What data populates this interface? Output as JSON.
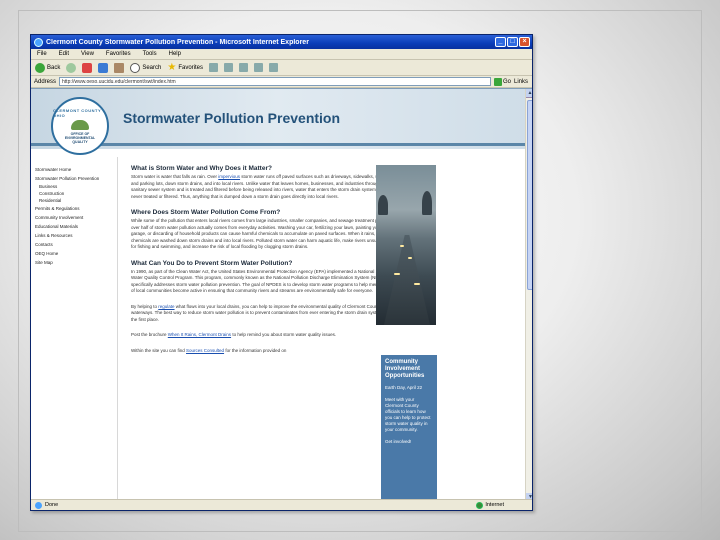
{
  "window": {
    "title": "Clermont County Stormwater Pollution Prevention - Microsoft Internet Explorer",
    "buttons": {
      "minimize": "_",
      "maximize": "□",
      "close": "×"
    }
  },
  "menu": [
    "File",
    "Edit",
    "View",
    "Favorites",
    "Tools",
    "Help"
  ],
  "toolbar": {
    "back": "Back",
    "search": "Search",
    "favorites": "Favorites"
  },
  "address": {
    "label": "Address",
    "url": "http://www.oeso.uucidu.edu/clermont/swt/index.htm",
    "go": "Go",
    "links": "Links"
  },
  "site": {
    "title": "Stormwater Pollution Prevention",
    "seal": {
      "ring": "CLERMONT COUNTY OHIO",
      "text": [
        "OFFICE OF",
        "ENVIRONMENTAL",
        "QUALITY"
      ]
    },
    "nav": [
      {
        "label": "Stormwater Home",
        "sub": false
      },
      {
        "label": "Stormwater Pollution Prevention",
        "sub": false
      },
      {
        "label": "Business",
        "sub": true
      },
      {
        "label": "Construction",
        "sub": true
      },
      {
        "label": "Residential",
        "sub": true
      },
      {
        "label": "Permits & Regulations",
        "sub": false
      },
      {
        "label": "Community Involvement",
        "sub": false
      },
      {
        "label": "Educational Materials",
        "sub": false
      },
      {
        "label": "Links & Resources",
        "sub": false
      },
      {
        "label": "Contacts",
        "sub": false
      },
      {
        "label": "OEQ Home",
        "sub": false
      },
      {
        "label": "Site Map",
        "sub": false
      }
    ],
    "sections": [
      {
        "title": "What is Storm Water and Why Does it Matter?",
        "body_pre": "Storm water is water that falls as rain. Over ",
        "link": "impervious",
        "body_post": " storm water runs off paved surfaces such as driveways, sidewalks, streets and parking lots, down storm drains, and into local rivers. Unlike water that leaves homes, businesses, and industries through the sanitary sewer system and is treated and filtered before being released into rivers, water that enters the storm drain system is never treated or filtered. Thus, anything that is dumped down a storm drain goes directly into local rivers."
      },
      {
        "title": "Where Does Storm Water Pollution Come From?",
        "body_pre": "While some of the pollution that enters local rivers comes from large industries, smaller companies, and sewage treatment plants, over half of storm water pollution actually comes from everyday activities. Washing your car, fertilizing your lawn, painting your garage, or discarding of household products can cause harmful chemicals to accumulate on paved surfaces. When it rains, these chemicals are washed down storm drains and into local rivers. Polluted storm water can harm aquatic life, make rivers unsuitable for fishing and swimming, and increase the risk of local flooding by clogging storm drains.",
        "link": "",
        "body_post": ""
      },
      {
        "title": "What Can You Do to Prevent Storm Water Pollution?",
        "body_pre": "In 1990, as part of the Clean Water Act, the United States Environmental Protection Agency (EPA) implemented a National Storm Water Quality Control Program. This program, commonly known as the National Pollution Discharge Elimination System (NPDES), specifically addresses storm water pollution prevention. The goal of NPDES is to develop storm water programs to help members of local communities become active in ensuring that community rivers and streams are environmentally safe for everyone.",
        "link": "",
        "body_post": ""
      }
    ],
    "para2_pre": "By helping to ",
    "para2_link": "regulate",
    "para2_post": " what flows into your local drains, you can help to improve the environmental quality of Clermont County's waterways. The best way to reduce storm water pollution is to prevent contaminates from ever entering the storm drain system in the first place.",
    "para3_pre": "Post the brochure ",
    "para3_link": "When It Rains, Clermont Drains",
    "para3_post": " to help remind you about storm water quality issues.",
    "para4_pre": "Within the site you can find ",
    "para4_link": "Sources Consulted",
    "para4_post": " for the information provided on",
    "sidebox": {
      "title": "Community Involvement Opportunities",
      "p1": "Earth Day, April 22",
      "p2": "Meet with your Clermont County officials to learn how you can help to protect storm water quality in your community.",
      "p3": "Get involved!"
    }
  },
  "status": {
    "text": "Done",
    "zone": "Internet"
  }
}
